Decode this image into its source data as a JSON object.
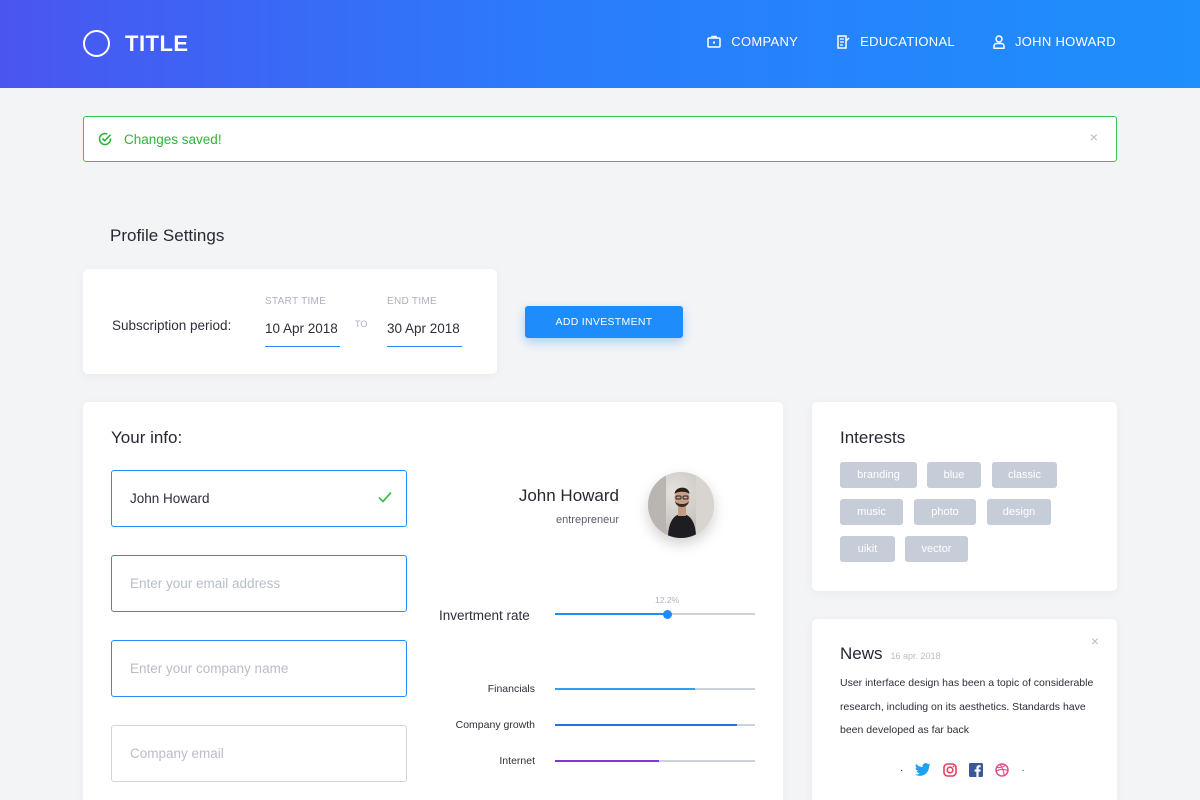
{
  "header": {
    "logo_text": "TITLE",
    "nav": [
      {
        "label": "COMPANY",
        "icon": "briefcase-icon"
      },
      {
        "label": "EDUCATIONAL",
        "icon": "document-icon"
      },
      {
        "label": "JOHN HOWARD",
        "icon": "user-icon"
      }
    ]
  },
  "alert": {
    "text": "Changes saved!",
    "close": "×",
    "color": "#2fb43b"
  },
  "page_title": "Profile Settings",
  "subscription": {
    "label": "Subscription period:",
    "start_caption": "START TIME",
    "start_value": "10 Apr 2018",
    "to": "TO",
    "end_caption": "END TIME",
    "end_value": "30 Apr 2018"
  },
  "add_investment_label": "ADD INVESTMENT",
  "info": {
    "title": "Your info:",
    "name_value": "John Howard",
    "email_placeholder": "Enter your email address",
    "company_placeholder": "Enter your company name",
    "company_email_placeholder": "Company email"
  },
  "profile": {
    "name": "John Howard",
    "role": "entrepreneur"
  },
  "investment": {
    "label": "Invertment rate",
    "value_text": "12.2%",
    "slider_fraction": 0.56
  },
  "bars": [
    {
      "label": "Financials",
      "fraction": 0.7,
      "color": "#2aa1f5"
    },
    {
      "label": "Company growth",
      "fraction": 0.91,
      "color": "#1f75e8"
    },
    {
      "label": "Internet",
      "fraction": 0.52,
      "color": "#7a3ad6"
    }
  ],
  "interests": {
    "title": "Interests",
    "tags": [
      "branding",
      "blue",
      "classic",
      "music",
      "photo",
      "design",
      "uikit",
      "vector"
    ]
  },
  "news": {
    "title": "News",
    "date": "16 apr. 2018",
    "close": "×",
    "body": "User interface design has been a topic of considerable research, including on its aesthetics. Standards have been developed as far back",
    "social": [
      {
        "name": "twitter-icon",
        "color": "#1da1f2"
      },
      {
        "name": "instagram-icon",
        "color": "#e4405f"
      },
      {
        "name": "facebook-icon",
        "color": "#3b5998"
      },
      {
        "name": "dribbble-icon",
        "color": "#ea4c89"
      }
    ]
  }
}
